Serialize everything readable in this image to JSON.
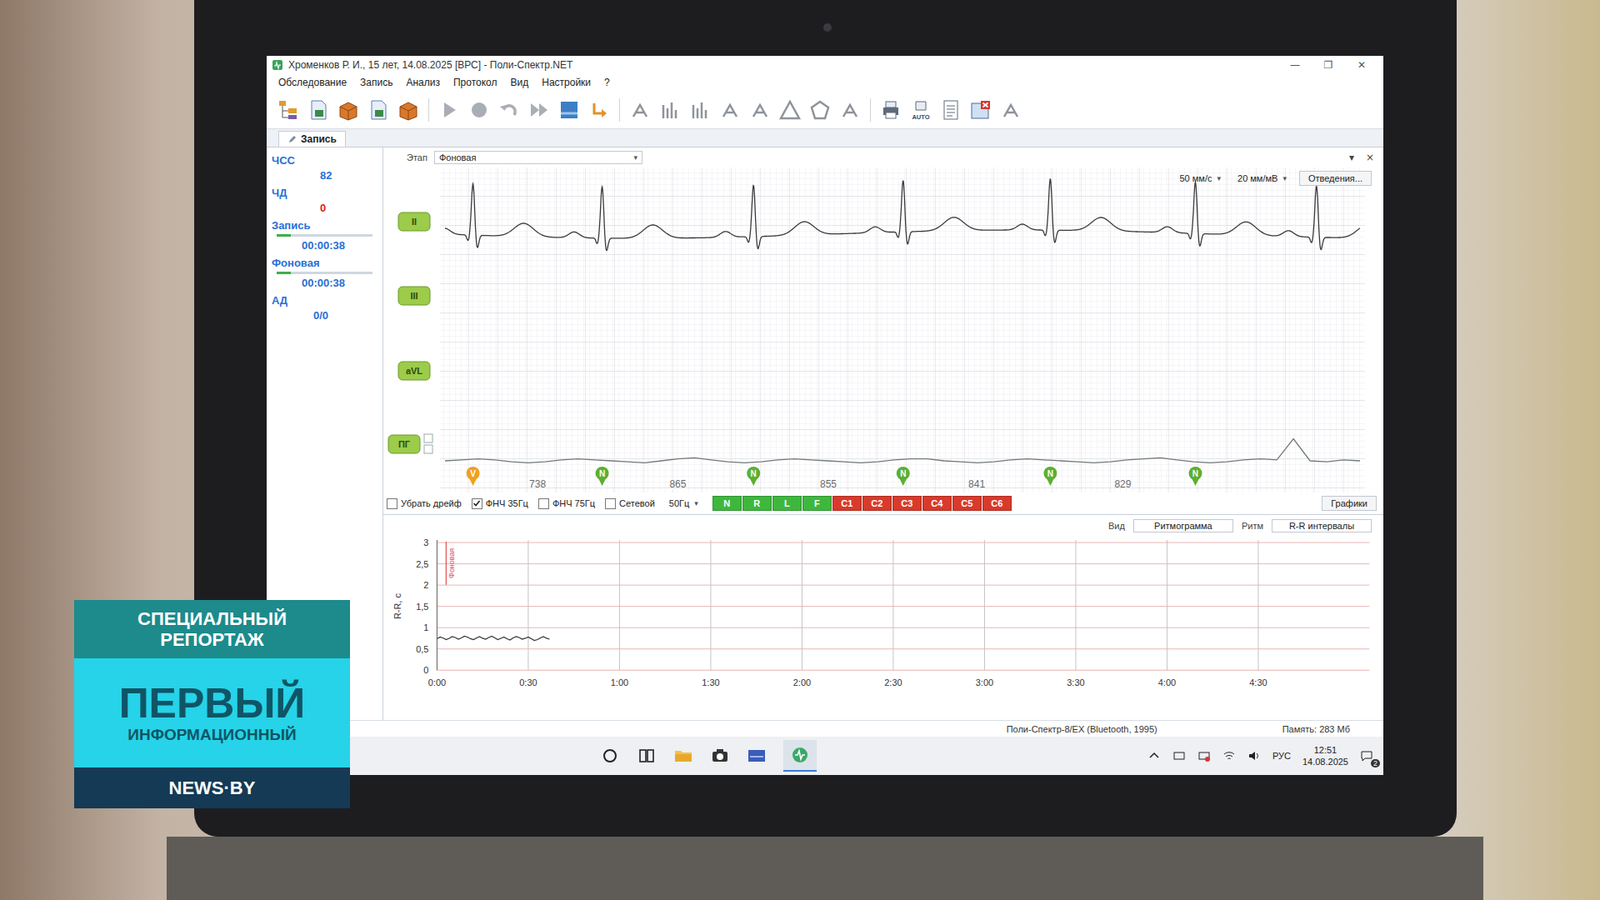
{
  "window": {
    "title": "Хроменков Р. И., 15 лет, 14.08.2025 [ВРС] - Поли-Спектр.NET",
    "controls": [
      "—",
      "❐",
      "✕"
    ]
  },
  "menu": [
    "Обследование",
    "Запись",
    "Анализ",
    "Протокол",
    "Вид",
    "Настройки",
    "?"
  ],
  "toolbar": {
    "auto_label": "AUTO"
  },
  "tabs": [
    {
      "label": "Запись",
      "selected": true
    }
  ],
  "vitals": [
    {
      "label": "ЧСС",
      "value": "82",
      "color": "#2a6fd6"
    },
    {
      "label": "ЧД",
      "value": "0",
      "color": "#e02020"
    }
  ],
  "timers": [
    {
      "label": "Запись",
      "time": "00:00:38",
      "level": 0.15
    },
    {
      "label": "Фоновая",
      "time": "00:00:38",
      "level": 0.15
    }
  ],
  "pressure": {
    "label": "АД",
    "value": "0/0"
  },
  "stage": {
    "label": "Этап",
    "value": "Фоновая",
    "panel_controls": [
      "▾",
      "×"
    ]
  },
  "dropdown_arrow": "▾",
  "scale": {
    "speed": "50 мм/с",
    "gain": "20 мм/мВ",
    "leads_button": "Отведения..."
  },
  "leads": [
    {
      "label": "II",
      "kind": "ecg",
      "peaks_ms": [
        160,
        898,
        1763,
        2618,
        3459,
        4288,
        4980
      ]
    },
    {
      "label": "III",
      "kind": "empty"
    },
    {
      "label": "aVL",
      "kind": "empty"
    },
    {
      "label": "ПГ",
      "kind": "curve",
      "values": [
        0,
        1,
        2,
        1,
        -1,
        -2,
        -1,
        1,
        2,
        1,
        0,
        -1,
        -2,
        0,
        2,
        3,
        1,
        -1,
        -2,
        -1,
        1,
        2,
        1,
        0,
        -1,
        -2,
        -1,
        1,
        2,
        2,
        0,
        -1,
        -2,
        -1,
        1,
        2,
        1,
        0,
        -1,
        -2,
        -1,
        1,
        2,
        3,
        1,
        -1,
        -2,
        -1,
        1,
        2,
        1,
        22,
        0,
        -1,
        1,
        0
      ]
    }
  ],
  "beats": {
    "marks": [
      {
        "label": "V",
        "color": "#f0a020"
      },
      {
        "label": "N",
        "color": "#5cb030"
      },
      {
        "label": "N",
        "color": "#5cb030"
      },
      {
        "label": "N",
        "color": "#5cb030"
      },
      {
        "label": "N",
        "color": "#5cb030"
      },
      {
        "label": "N",
        "color": "#5cb030"
      }
    ],
    "rr": [
      "738",
      "865",
      "855",
      "841",
      "829"
    ]
  },
  "filters": [
    {
      "label": "Убрать дрейф",
      "checked": false
    },
    {
      "label": "ФНЧ 35Гц",
      "checked": true
    },
    {
      "label": "ФНЧ 75Гц",
      "checked": false
    },
    {
      "label": "Сетевой",
      "checked": false
    }
  ],
  "mains_freq": "50Гц",
  "classes": [
    {
      "label": "N",
      "color": "#3db83d"
    },
    {
      "label": "R",
      "color": "#3db83d"
    },
    {
      "label": "L",
      "color": "#3db83d"
    },
    {
      "label": "F",
      "color": "#3db83d"
    },
    {
      "label": "C1",
      "color": "#d93a2b"
    },
    {
      "label": "C2",
      "color": "#d93a2b"
    },
    {
      "label": "C3",
      "color": "#d93a2b"
    },
    {
      "label": "C4",
      "color": "#d93a2b"
    },
    {
      "label": "C5",
      "color": "#d93a2b"
    },
    {
      "label": "C6",
      "color": "#d93a2b"
    }
  ],
  "graphs_button": "Графики",
  "rhythm": {
    "view_label": "Вид",
    "view": "Ритмограмма",
    "rhythm_label": "Ритм",
    "rhythm": "R-R интервалы",
    "y_label": "R-R, c",
    "y_ticks": [
      "3",
      "2,5",
      "2",
      "1,5",
      "1",
      "0,5",
      "0"
    ],
    "x_ticks": [
      "0:00",
      "0:30",
      "1:00",
      "1:30",
      "2:00",
      "2:30",
      "3:00",
      "3:30",
      "4:00",
      "4:30"
    ],
    "series": [
      0.74,
      0.78,
      0.76,
      0.72,
      0.75,
      0.79,
      0.77,
      0.73,
      0.76,
      0.8,
      0.78,
      0.74,
      0.72,
      0.76,
      0.79,
      0.75,
      0.73,
      0.77,
      0.8,
      0.76,
      0.72,
      0.75,
      0.78,
      0.74,
      0.71,
      0.76,
      0.79,
      0.77,
      0.73,
      0.75,
      0.78,
      0.74,
      0.7,
      0.72,
      0.76,
      0.79,
      0.75,
      0.73
    ],
    "marker": {
      "label": "Фоновая",
      "t": 3,
      "color": "#e05050"
    }
  },
  "status_bar": {
    "device": "Поли-Спектр-8/EX (Bluetooth, 1995)",
    "memory": "Память: 283 Мб"
  },
  "taskbar": {
    "language": "РУС",
    "time": "12:51",
    "date": "14.08.2025",
    "notifications": "2"
  },
  "overlay": {
    "kicker": "СПЕЦИАЛЬНЫЙ РЕПОРТАЖ",
    "title": "ПЕРВЫЙ",
    "subtitle": "ИНФОРМАЦИОННЫЙ",
    "site": "NEWS·BY"
  }
}
